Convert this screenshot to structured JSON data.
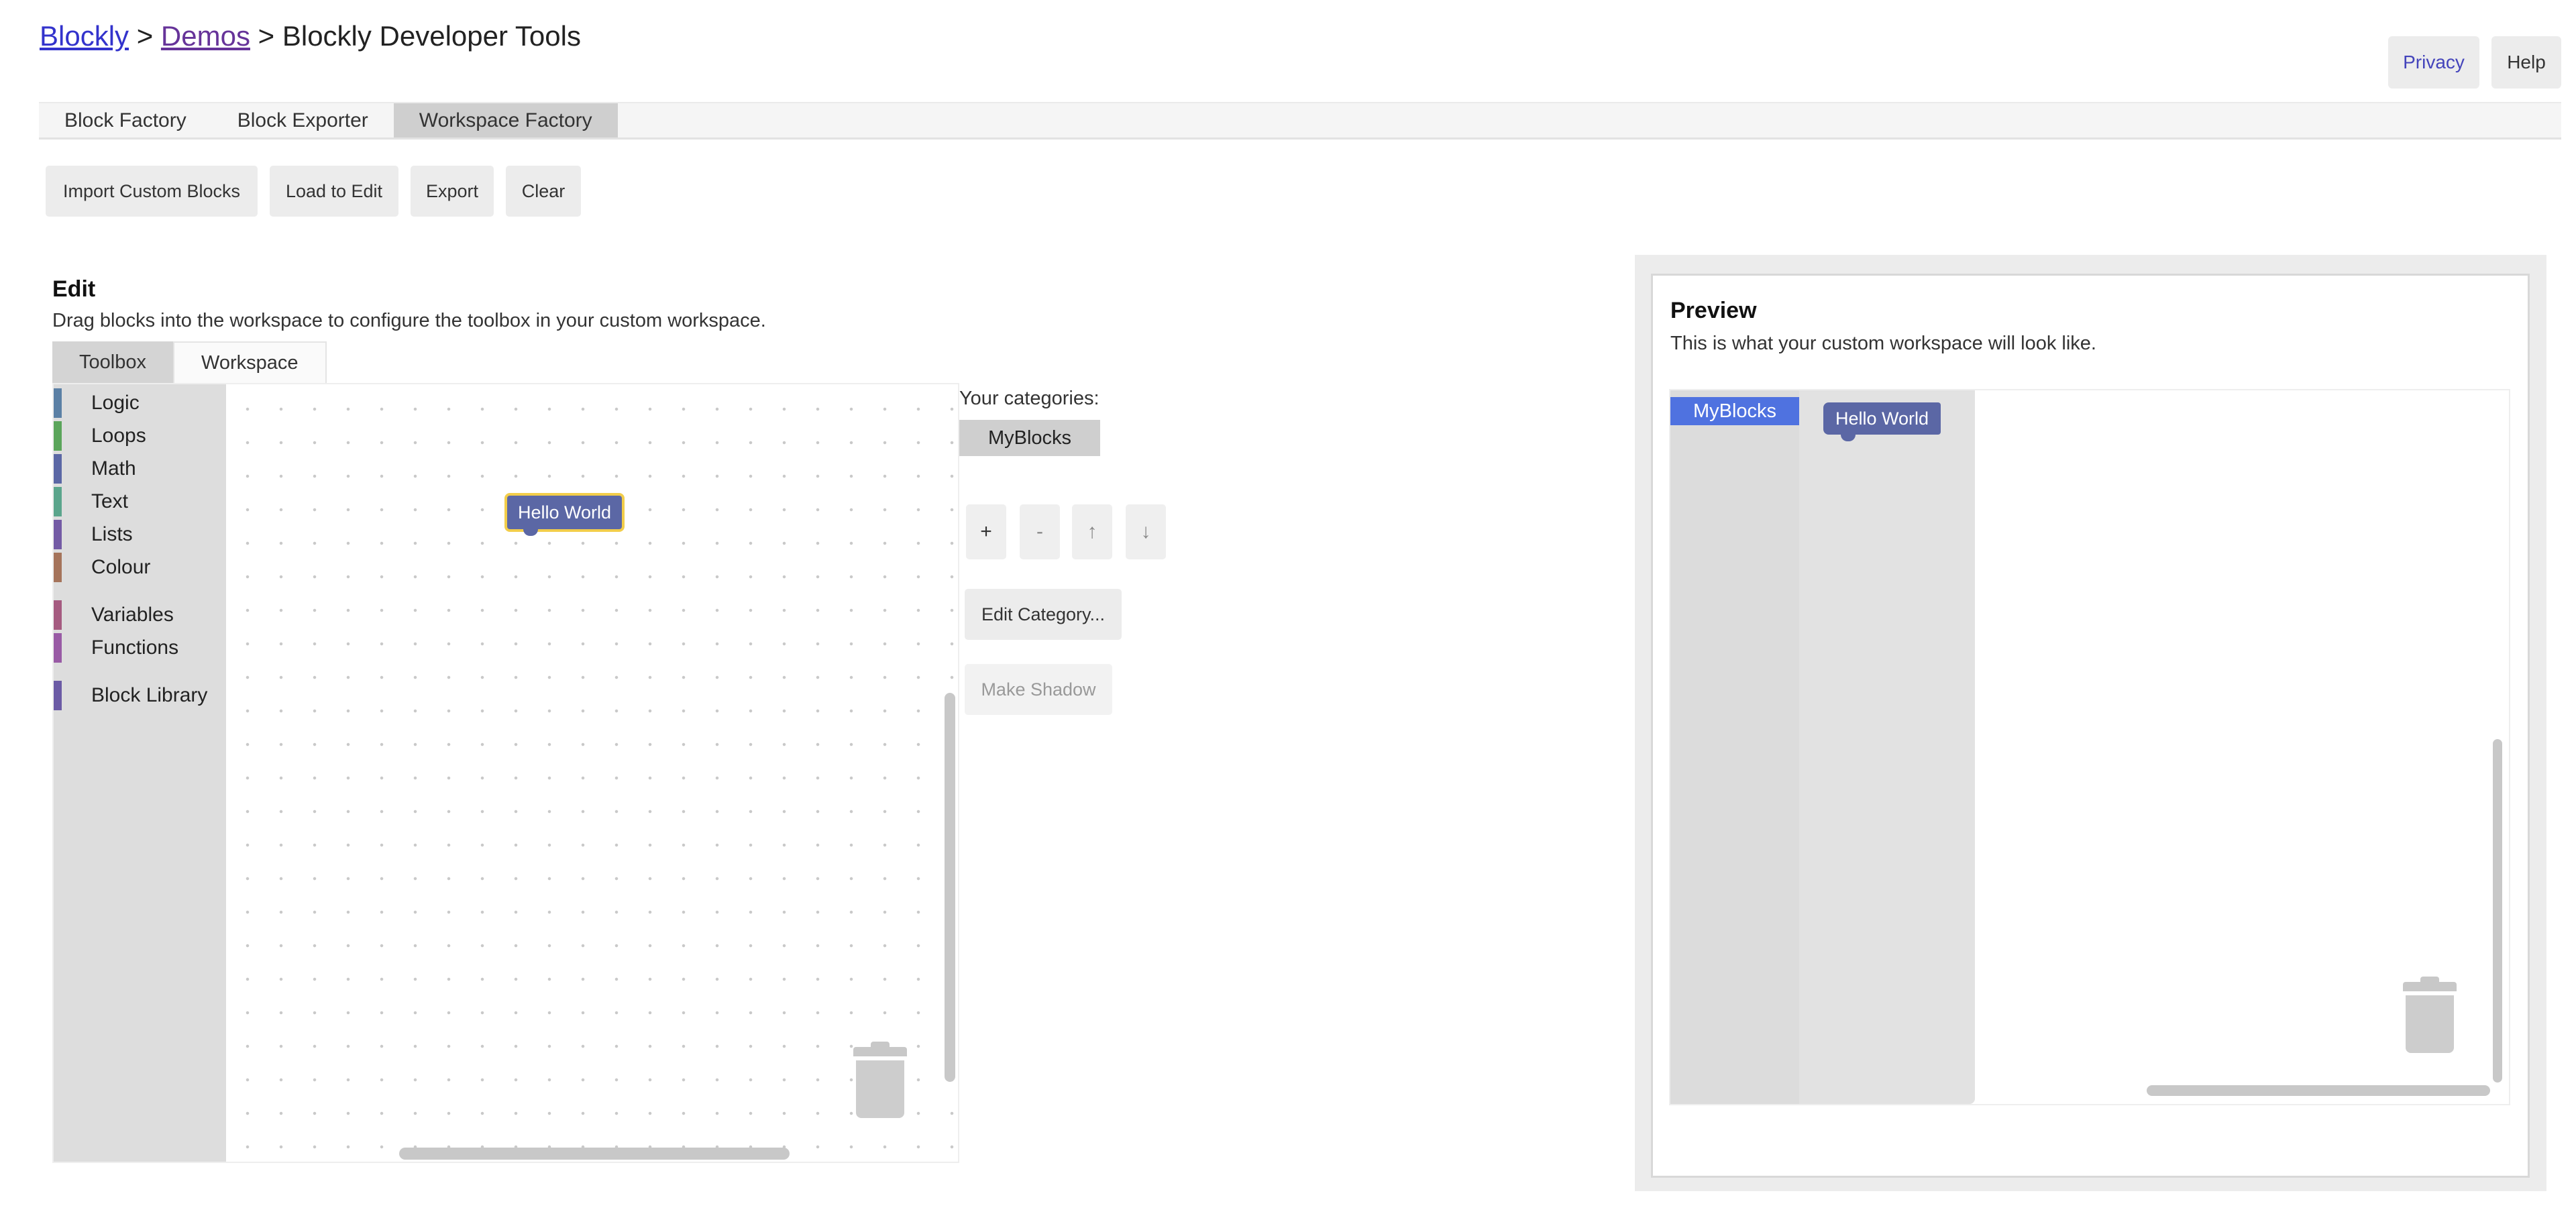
{
  "breadcrumb": {
    "items": [
      {
        "label": "Blockly",
        "link": true
      },
      {
        "label": "Demos",
        "link": true
      },
      {
        "label": "Blockly Developer Tools",
        "link": false
      }
    ],
    "separator": ">"
  },
  "header_buttons": {
    "privacy": "Privacy",
    "help": "Help"
  },
  "main_tabs": [
    {
      "label": "Block Factory",
      "active": false
    },
    {
      "label": "Block Exporter",
      "active": false
    },
    {
      "label": "Workspace Factory",
      "active": true
    }
  ],
  "toolbar": {
    "import_label": "Import Custom Blocks",
    "load_label": "Load to Edit",
    "export_label": "Export",
    "clear_label": "Clear"
  },
  "edit": {
    "title": "Edit",
    "description": "Drag blocks into the workspace to configure the toolbox in your custom workspace.",
    "subtabs": [
      {
        "label": "Toolbox",
        "active": true
      },
      {
        "label": "Workspace",
        "active": false
      }
    ],
    "toolbox_categories": [
      {
        "label": "Logic",
        "color": "#5b80a5"
      },
      {
        "label": "Loops",
        "color": "#5ba55b"
      },
      {
        "label": "Math",
        "color": "#5b67a5"
      },
      {
        "label": "Text",
        "color": "#5ba58c"
      },
      {
        "label": "Lists",
        "color": "#745ba5"
      },
      {
        "label": "Colour",
        "color": "#a5745b"
      },
      {
        "label": "Variables",
        "color": "#a55b80"
      },
      {
        "label": "Functions",
        "color": "#995ba5"
      },
      {
        "label": "Block Library",
        "color": "#6b5ba5"
      }
    ],
    "workspace_block": "Hello World"
  },
  "categories_panel": {
    "heading": "Your categories:",
    "selected_category": "MyBlocks",
    "add_label": "+",
    "remove_label": "-",
    "up_label": "↑",
    "down_label": "↓",
    "edit_category_label": "Edit Category...",
    "make_shadow_label": "Make Shadow"
  },
  "preview": {
    "title": "Preview",
    "description": "This is what your custom workspace will look like.",
    "category": "MyBlocks",
    "category_color": "#4f72e0",
    "flyout_block": "Hello World"
  },
  "colors": {
    "block": "#5b67a5",
    "selection_highlight": "#f2cd4a"
  }
}
